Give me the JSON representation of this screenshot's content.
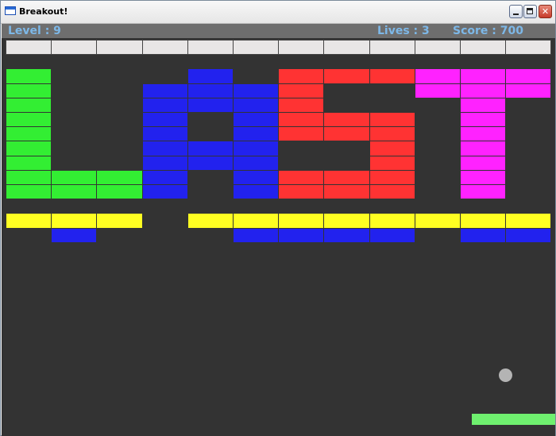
{
  "window": {
    "title": "Breakout!"
  },
  "hud": {
    "level_text": "Level : 9",
    "lives_text": "Lives : 3",
    "score_text": "Score : 700"
  },
  "colors": {
    "grey": "#e8e6e6",
    "green": "#33ee33",
    "blue": "#2222ee",
    "red": "#ff3333",
    "magenta": "#ff22ff",
    "yellow": "#ffff22"
  },
  "icons": [
    "app-icon",
    "minimize-icon",
    "maximize-icon",
    "close-icon"
  ],
  "bricks": [
    {
      "r": 0,
      "c": 0,
      "color": "grey"
    },
    {
      "r": 0,
      "c": 1,
      "color": "grey"
    },
    {
      "r": 0,
      "c": 2,
      "color": "grey"
    },
    {
      "r": 0,
      "c": 3,
      "color": "grey"
    },
    {
      "r": 0,
      "c": 4,
      "color": "grey"
    },
    {
      "r": 0,
      "c": 5,
      "color": "grey"
    },
    {
      "r": 0,
      "c": 6,
      "color": "grey"
    },
    {
      "r": 0,
      "c": 7,
      "color": "grey"
    },
    {
      "r": 0,
      "c": 8,
      "color": "grey"
    },
    {
      "r": 0,
      "c": 9,
      "color": "grey"
    },
    {
      "r": 0,
      "c": 10,
      "color": "grey"
    },
    {
      "r": 0,
      "c": 11,
      "color": "grey"
    },
    {
      "r": 2,
      "c": 0,
      "color": "green"
    },
    {
      "r": 2,
      "c": 4,
      "color": "blue"
    },
    {
      "r": 2,
      "c": 6,
      "color": "red"
    },
    {
      "r": 2,
      "c": 7,
      "color": "red"
    },
    {
      "r": 2,
      "c": 8,
      "color": "red"
    },
    {
      "r": 2,
      "c": 9,
      "color": "magenta"
    },
    {
      "r": 2,
      "c": 10,
      "color": "magenta"
    },
    {
      "r": 2,
      "c": 11,
      "color": "magenta"
    },
    {
      "r": 3,
      "c": 0,
      "color": "green"
    },
    {
      "r": 3,
      "c": 3,
      "color": "blue"
    },
    {
      "r": 3,
      "c": 4,
      "color": "blue"
    },
    {
      "r": 3,
      "c": 5,
      "color": "blue"
    },
    {
      "r": 3,
      "c": 6,
      "color": "red"
    },
    {
      "r": 3,
      "c": 9,
      "color": "magenta"
    },
    {
      "r": 3,
      "c": 10,
      "color": "magenta"
    },
    {
      "r": 3,
      "c": 11,
      "color": "magenta"
    },
    {
      "r": 4,
      "c": 0,
      "color": "green"
    },
    {
      "r": 4,
      "c": 3,
      "color": "blue"
    },
    {
      "r": 4,
      "c": 4,
      "color": "blue"
    },
    {
      "r": 4,
      "c": 5,
      "color": "blue"
    },
    {
      "r": 4,
      "c": 6,
      "color": "red"
    },
    {
      "r": 4,
      "c": 10,
      "color": "magenta"
    },
    {
      "r": 5,
      "c": 0,
      "color": "green"
    },
    {
      "r": 5,
      "c": 3,
      "color": "blue"
    },
    {
      "r": 5,
      "c": 5,
      "color": "blue"
    },
    {
      "r": 5,
      "c": 6,
      "color": "red"
    },
    {
      "r": 5,
      "c": 7,
      "color": "red"
    },
    {
      "r": 5,
      "c": 8,
      "color": "red"
    },
    {
      "r": 5,
      "c": 10,
      "color": "magenta"
    },
    {
      "r": 6,
      "c": 0,
      "color": "green"
    },
    {
      "r": 6,
      "c": 3,
      "color": "blue"
    },
    {
      "r": 6,
      "c": 5,
      "color": "blue"
    },
    {
      "r": 6,
      "c": 6,
      "color": "red"
    },
    {
      "r": 6,
      "c": 7,
      "color": "red"
    },
    {
      "r": 6,
      "c": 8,
      "color": "red"
    },
    {
      "r": 6,
      "c": 10,
      "color": "magenta"
    },
    {
      "r": 7,
      "c": 0,
      "color": "green"
    },
    {
      "r": 7,
      "c": 3,
      "color": "blue"
    },
    {
      "r": 7,
      "c": 4,
      "color": "blue"
    },
    {
      "r": 7,
      "c": 5,
      "color": "blue"
    },
    {
      "r": 7,
      "c": 8,
      "color": "red"
    },
    {
      "r": 7,
      "c": 10,
      "color": "magenta"
    },
    {
      "r": 8,
      "c": 0,
      "color": "green"
    },
    {
      "r": 8,
      "c": 3,
      "color": "blue"
    },
    {
      "r": 8,
      "c": 4,
      "color": "blue"
    },
    {
      "r": 8,
      "c": 5,
      "color": "blue"
    },
    {
      "r": 8,
      "c": 8,
      "color": "red"
    },
    {
      "r": 8,
      "c": 10,
      "color": "magenta"
    },
    {
      "r": 9,
      "c": 0,
      "color": "green"
    },
    {
      "r": 9,
      "c": 1,
      "color": "green"
    },
    {
      "r": 9,
      "c": 2,
      "color": "green"
    },
    {
      "r": 9,
      "c": 3,
      "color": "blue"
    },
    {
      "r": 9,
      "c": 5,
      "color": "blue"
    },
    {
      "r": 9,
      "c": 6,
      "color": "red"
    },
    {
      "r": 9,
      "c": 7,
      "color": "red"
    },
    {
      "r": 9,
      "c": 8,
      "color": "red"
    },
    {
      "r": 9,
      "c": 10,
      "color": "magenta"
    },
    {
      "r": 10,
      "c": 0,
      "color": "green"
    },
    {
      "r": 10,
      "c": 1,
      "color": "green"
    },
    {
      "r": 10,
      "c": 2,
      "color": "green"
    },
    {
      "r": 10,
      "c": 3,
      "color": "blue"
    },
    {
      "r": 10,
      "c": 5,
      "color": "blue"
    },
    {
      "r": 10,
      "c": 6,
      "color": "red"
    },
    {
      "r": 10,
      "c": 7,
      "color": "red"
    },
    {
      "r": 10,
      "c": 8,
      "color": "red"
    },
    {
      "r": 10,
      "c": 10,
      "color": "magenta"
    },
    {
      "r": 12,
      "c": 0,
      "color": "yellow"
    },
    {
      "r": 12,
      "c": 1,
      "color": "yellow"
    },
    {
      "r": 12,
      "c": 2,
      "color": "yellow"
    },
    {
      "r": 12,
      "c": 4,
      "color": "yellow"
    },
    {
      "r": 12,
      "c": 5,
      "color": "yellow"
    },
    {
      "r": 12,
      "c": 6,
      "color": "yellow"
    },
    {
      "r": 12,
      "c": 7,
      "color": "yellow"
    },
    {
      "r": 12,
      "c": 8,
      "color": "yellow"
    },
    {
      "r": 12,
      "c": 9,
      "color": "yellow"
    },
    {
      "r": 12,
      "c": 10,
      "color": "yellow"
    },
    {
      "r": 12,
      "c": 11,
      "color": "yellow"
    },
    {
      "r": 13,
      "c": 1,
      "color": "blue"
    },
    {
      "r": 13,
      "c": 5,
      "color": "blue"
    },
    {
      "r": 13,
      "c": 6,
      "color": "blue"
    },
    {
      "r": 13,
      "c": 7,
      "color": "blue"
    },
    {
      "r": 13,
      "c": 8,
      "color": "blue"
    },
    {
      "r": 13,
      "c": 10,
      "color": "blue"
    },
    {
      "r": 13,
      "c": 11,
      "color": "blue"
    }
  ]
}
